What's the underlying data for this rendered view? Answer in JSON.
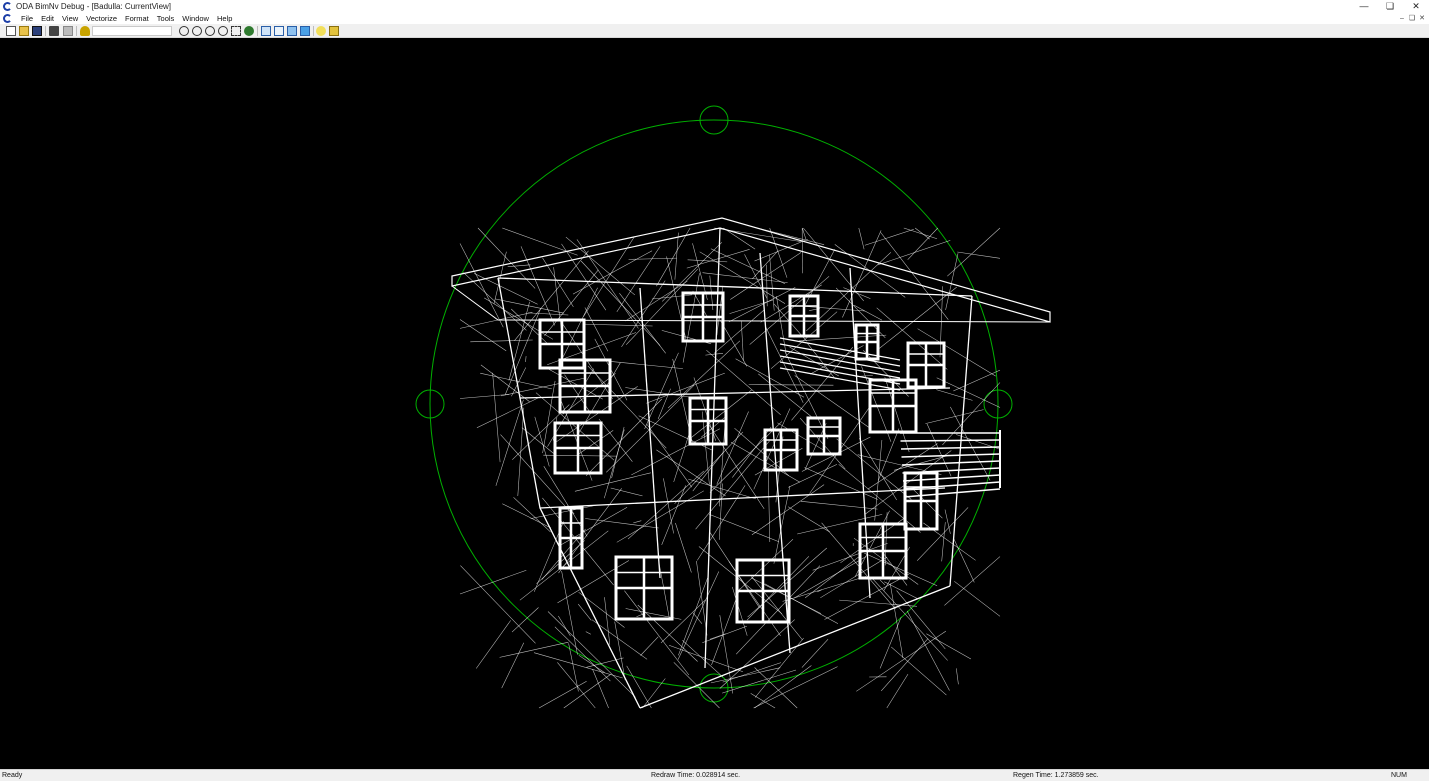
{
  "window": {
    "title": "ODA BimNv Debug - [Badulla: CurrentView]",
    "controls": [
      "—",
      "❏",
      "✕"
    ],
    "mdi_controls": [
      "–",
      "❏",
      "✕"
    ]
  },
  "menu": {
    "items": [
      "File",
      "Edit",
      "View",
      "Vectorize",
      "Format",
      "Tools",
      "Window",
      "Help"
    ]
  },
  "toolbar": {
    "buttons": [
      "new-icon",
      "open-icon",
      "save-icon",
      "print-icon",
      "print-preview-icon",
      "help-icon",
      "zoom-extents-icon",
      "zoom-in-icon",
      "zoom-out-icon",
      "zoom-window-icon",
      "orbit-icon",
      "pan-icon",
      "wireframe-icon",
      "hidden-icon",
      "shaded-icon",
      "gouraud-icon",
      "light-icon",
      "properties-icon"
    ]
  },
  "viewport": {
    "background": "#000000",
    "model_color": "#ffffff",
    "orbit_color": "#00b000"
  },
  "status": {
    "ready": "Ready",
    "redraw": "Redraw Time: 0.028914 sec.",
    "regen": "Regen Time: 1.273859 sec.",
    "num": "NUM"
  }
}
